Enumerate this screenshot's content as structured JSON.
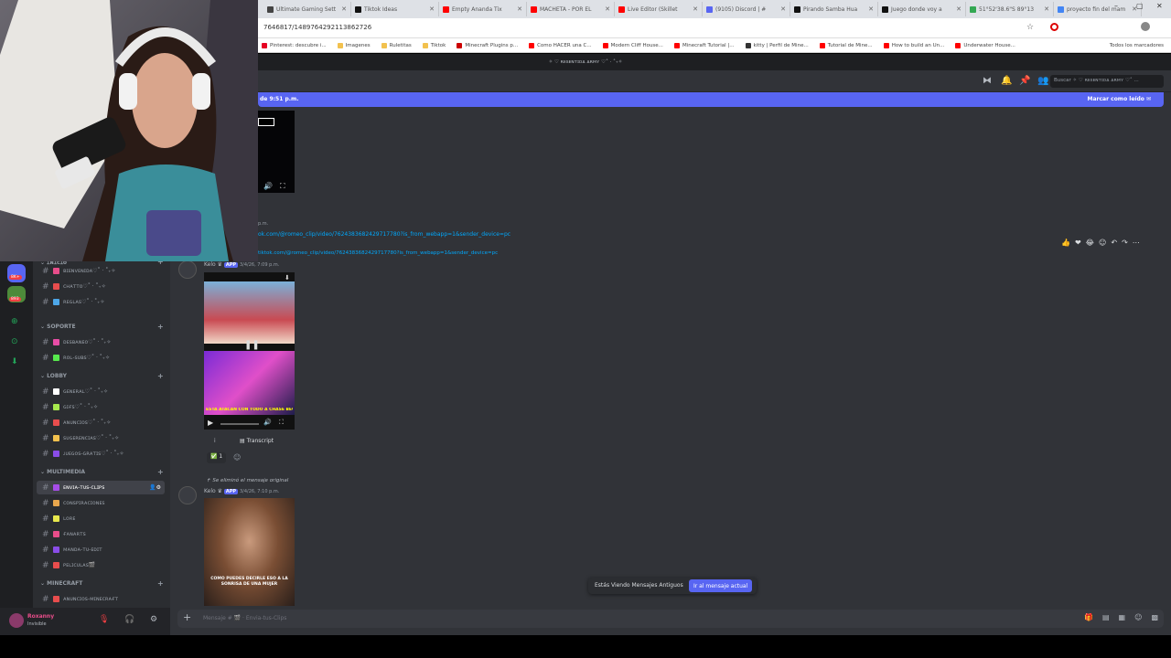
{
  "browser": {
    "tabs": [
      {
        "label": "Ultimate Gaming Sett",
        "color": "#444"
      },
      {
        "label": "Tiktok Ideas",
        "color": "#111"
      },
      {
        "label": "Empty Ananda Tix",
        "color": "#ff0000"
      },
      {
        "label": "MACHETA - POR EL",
        "color": "#ff0000"
      },
      {
        "label": "Live Editor (Skillet",
        "color": "#ff0000"
      },
      {
        "label": "(9105) Discord | #",
        "color": "#5865f2"
      },
      {
        "label": "Pirando Samba Hua",
        "color": "#111"
      },
      {
        "label": "Juego donde voy a",
        "color": "#111"
      },
      {
        "label": "51°52'38.6\"S 89°13",
        "color": "#34a853"
      },
      {
        "label": "proyecto fin del mam",
        "color": "#4285f4"
      }
    ],
    "url": "7646817/1489764292113862726",
    "bookmarks": [
      {
        "label": "Pinterest: descubre i...",
        "color": "#e60023"
      },
      {
        "label": "Imagenes",
        "color": "#f2c14e"
      },
      {
        "label": "Ruletitas",
        "color": "#f2c14e"
      },
      {
        "label": "Tiktok",
        "color": "#f2c14e"
      },
      {
        "label": "Minecraft Plugins p...",
        "color": "#cc0000"
      },
      {
        "label": "Como HACER una C...",
        "color": "#ff0000"
      },
      {
        "label": "Modern Cliff House...",
        "color": "#ff0000"
      },
      {
        "label": "Minecraft Tutorial |...",
        "color": "#ff0000"
      },
      {
        "label": "kitty | Perfil de Mine...",
        "color": "#333"
      },
      {
        "label": "Tutorial de Mine...",
        "color": "#ff0000"
      },
      {
        "label": "How to build an Un...",
        "color": "#ff0000"
      },
      {
        "label": "Underwater House...",
        "color": "#ff0000"
      }
    ],
    "all_bookmarks": "Todos los marcadores"
  },
  "discord": {
    "server_title": "✧ ♡ ʀᴇsᴇɴᴛɪᴅᴀ ᴀʀᴍʏ ♡˚ · ˚₊✧",
    "search_placeholder": "Buscar ✧ ♡ ʀᴇsᴇɴᴛɪᴅᴀ ᴀʀᴍʏ ♡˚ ...",
    "new_messages_text": "de 9:51 p.m.",
    "mark_read": "Marcar como leído",
    "server_badges": [
      "8K+",
      "893"
    ],
    "categories": [
      {
        "label": "ɪɴɪᴄɪᴏ"
      },
      {
        "label": "SOPORTE"
      },
      {
        "label": "LOBBY"
      },
      {
        "label": "MULTIMEDIA"
      },
      {
        "label": "MINECRAFT"
      }
    ],
    "channels": [
      {
        "label": "ʙɪᴇɴᴠᴇɴɪᴅᴀ♡˚ · ˚₊✧",
        "color": "#e84d8a"
      },
      {
        "label": "ᴄʜᴀᴛᴛᴏ♡˚ · ˚₊✧",
        "color": "#e84d4d"
      },
      {
        "label": "ʀᴇɢʟᴀs♡˚ · ˚₊✧",
        "color": "#4da6e8"
      },
      {
        "label": "ᴅᴇsʙᴀɴᴇᴏ♡˚ · ˚₊✧",
        "color": "#e84da6"
      },
      {
        "label": "ʀᴏʟ-sᴜʙs♡˚ · ˚₊✧",
        "color": "#57e84d"
      },
      {
        "label": "ɢᴇɴᴇʀᴀʟ♡˚ · ˚₊✧",
        "color": "#ffffff"
      },
      {
        "label": "ɢɪғs♡˚ · ˚₊✧",
        "color": "#a6e84d"
      },
      {
        "label": "ᴀɴᴜɴᴄɪᴏs♡˚ · ˚₊✧",
        "color": "#e84d4d"
      },
      {
        "label": "sᴜɢᴇʀᴇɴᴄɪᴀs♡˚ · ˚₊✧",
        "color": "#f2c14e"
      },
      {
        "label": "ᴊᴜᴇɢᴏs-ɢʀᴀᴛɪs♡˚ · ˚₊✧",
        "color": "#8a4de8"
      },
      {
        "label": "ᴇɴᴠɪᴀ-ᴛᴜs-ᴄʟɪᴘs",
        "color": "#a64de8"
      },
      {
        "label": "ᴄᴏɴsᴘɪʀᴀᴄɪᴏɴᴇs",
        "color": "#e8a64d"
      },
      {
        "label": "ʟᴏʀᴇ",
        "color": "#e8e84d"
      },
      {
        "label": "ғᴀɴᴀʀᴛs",
        "color": "#e84d8a"
      },
      {
        "label": "ᴍᴀɴᴅᴀ-ᴛᴜ-ᴇᴅɪᴛ",
        "color": "#8a4de8"
      },
      {
        "label": "ᴘᴇʟɪᴄᴜʟᴀs🎬",
        "color": "#e84d4d"
      },
      {
        "label": "ᴀɴᴜɴᴄɪᴏs-ᴍɪɴᴇᴄʀᴀғᴛ",
        "color": "#e84d4d"
      }
    ],
    "user": {
      "name": "Roxanny",
      "status": "Invisible"
    },
    "chat_placeholder": "Mensaje # 🎬 · Envia-tus-Clips",
    "messages": {
      "time_small": "p.m.",
      "link1": "ok.com/@romeo_clip/video/7624383682429717780?is_from_webapp=1&sender_device=pc",
      "link2": "tiktok.com/@romeo_clip/video/7624383682429717780?is_from_webapp=1&sender_device=pc",
      "author1": "Kelo",
      "app_badge": "APP",
      "date1": "3/4/26, 7:09 p.m.",
      "video1_caption": "ESTA ATACAN CON TODO A CHASE BECERRA",
      "transcript": "Transcript",
      "reaction_count": "1",
      "deleted_reply": "Se eliminó el mensaje original",
      "author2": "Kelo",
      "date2": "3/4/26, 7:10 p.m.",
      "video2_caption": "COMO PUEDES DECIRLE ESO A LA SONRISA DE UNA MUJER"
    },
    "older_messages": "Estás Viendo Mensajes Antiguos",
    "jump_button": "Ir al mensaje actual"
  }
}
